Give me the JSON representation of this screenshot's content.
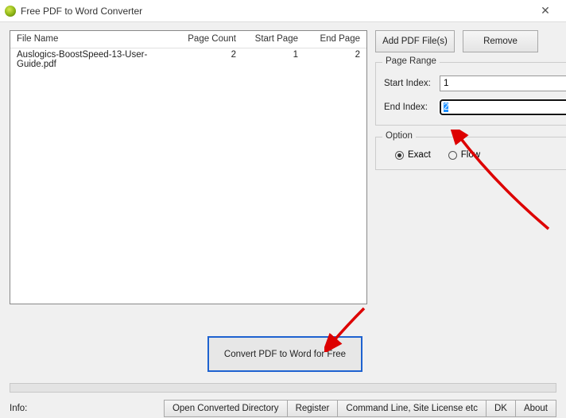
{
  "window": {
    "title": "Free PDF to Word Converter"
  },
  "table": {
    "headers": {
      "file": "File Name",
      "count": "Page Count",
      "start": "Start Page",
      "end": "End Page"
    },
    "rows": [
      {
        "file": "Auslogics-BoostSpeed-13-User-Guide.pdf",
        "count": "2",
        "start": "1",
        "end": "2"
      }
    ]
  },
  "buttons": {
    "add": "Add PDF File(s)",
    "remove": "Remove",
    "convert": "Convert PDF to Word for Free"
  },
  "pageRange": {
    "legend": "Page Range",
    "startLabel": "Start Index:",
    "endLabel": "End Index:",
    "start": "1",
    "end": "2"
  },
  "option": {
    "legend": "Option",
    "exact": "Exact",
    "flow": "Flow",
    "selected": "exact"
  },
  "footer": {
    "info": "Info:",
    "openDir": "Open Converted Directory",
    "register": "Register",
    "cmdLine": "Command Line, Site License etc",
    "buy": "DK",
    "about": "About"
  }
}
